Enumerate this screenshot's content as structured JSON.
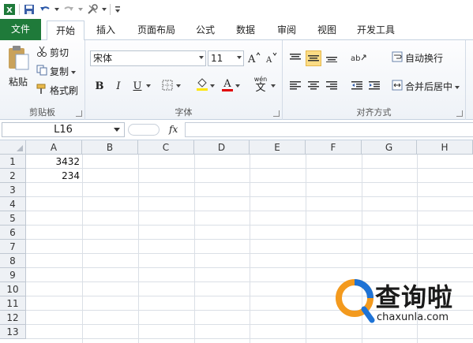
{
  "quick_access": {
    "icons": [
      "excel-logo-icon",
      "save-icon",
      "undo-icon",
      "redo-icon",
      "tools-icon",
      "customize-icon"
    ]
  },
  "tabs": [
    {
      "label": "文件"
    },
    {
      "label": "开始"
    },
    {
      "label": "插入"
    },
    {
      "label": "页面布局"
    },
    {
      "label": "公式"
    },
    {
      "label": "数据"
    },
    {
      "label": "审阅"
    },
    {
      "label": "视图"
    },
    {
      "label": "开发工具"
    }
  ],
  "ribbon": {
    "clipboard": {
      "label": "剪贴板",
      "paste": "粘贴",
      "cut": "剪切",
      "copy": "复制",
      "format_painter": "格式刷"
    },
    "font": {
      "label": "字体",
      "font_name": "宋体",
      "font_size": "11",
      "bold": "B",
      "italic": "I",
      "underline": "U",
      "font_color": "A",
      "phonetic": "wén"
    },
    "alignment": {
      "label": "对齐方式",
      "wrap_text": "自动换行",
      "merge_center": "合并后居中"
    }
  },
  "formula_bar": {
    "name_box": "L16",
    "fx": "fx",
    "content": ""
  },
  "sheet": {
    "columns": [
      "A",
      "B",
      "C",
      "D",
      "E",
      "F",
      "G",
      "H"
    ],
    "rows": [
      "1",
      "2",
      "3",
      "4",
      "5",
      "6",
      "7",
      "8",
      "9",
      "10",
      "11",
      "12",
      "13"
    ],
    "cells": {
      "A1": "3432",
      "A2": "234"
    }
  },
  "watermark": {
    "brand": "查询啦",
    "url": "chaxunla.com"
  },
  "colors": {
    "file_tab": "#1f7a3a",
    "font_color_bar": "#e00000",
    "highlight_bar": "#ffe600",
    "watermark_orange": "#f39a1e",
    "watermark_blue": "#1e73d6"
  }
}
